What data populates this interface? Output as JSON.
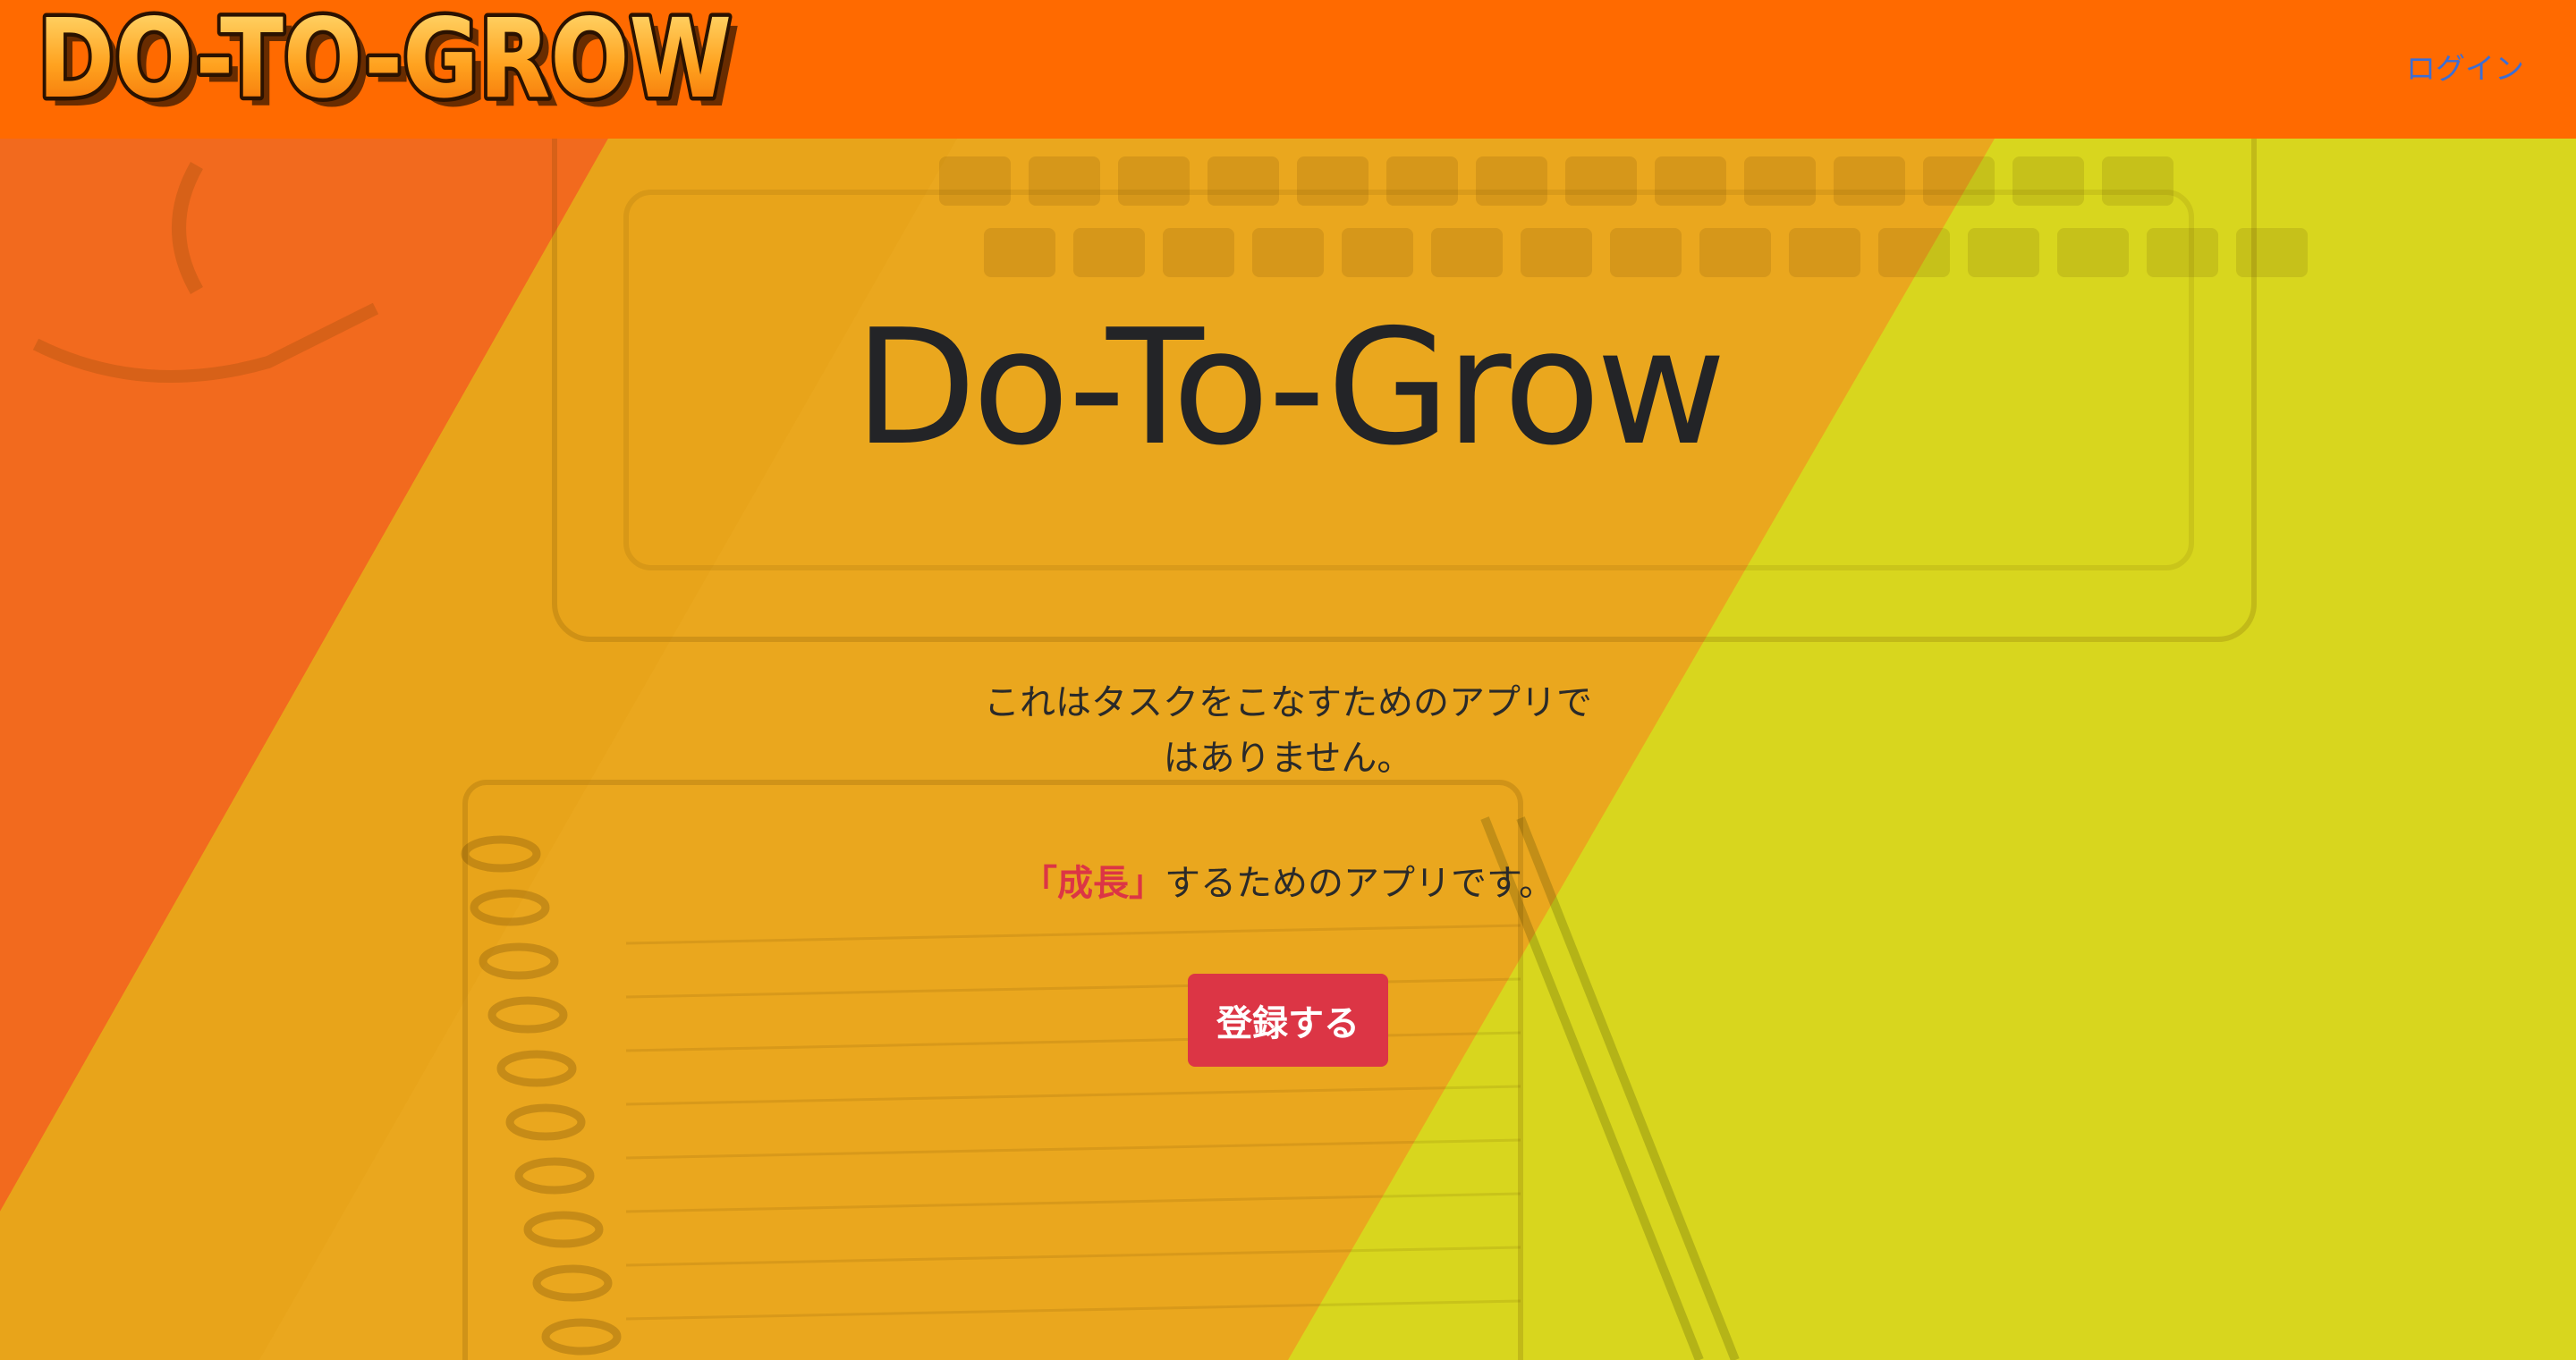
{
  "header": {
    "logo_text": "DO-TO-GROW",
    "login_label": "ログイン"
  },
  "hero": {
    "title": "Do-To-Grow",
    "description": "これはタスクをこなすためのアプリではありません。",
    "tagline_highlight": "「成長」",
    "tagline_rest": "するためのアプリです。",
    "register_label": "登録する"
  },
  "colors": {
    "header_bg": "#ff6a00",
    "accent_red": "#dc3545",
    "link_blue": "#3b6ed6",
    "panel_orange": "#f26a1e",
    "panel_amber": "#e8a41a",
    "panel_yellow": "#d8d61e"
  }
}
